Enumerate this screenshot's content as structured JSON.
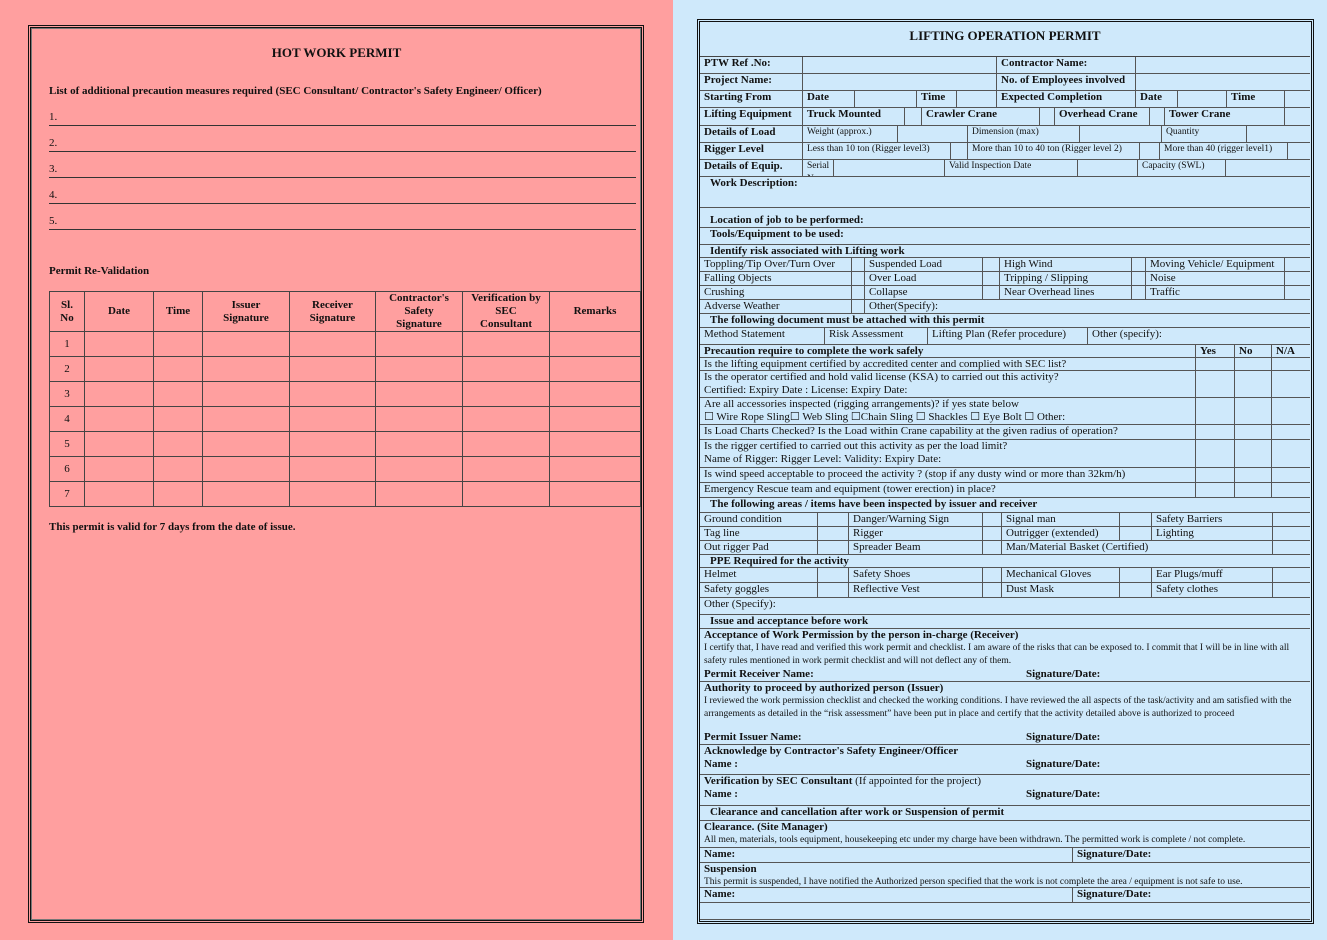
{
  "hot_work": {
    "title": "HOT WORK PERMIT",
    "precaution_heading": "List of additional precaution measures required (SEC Consultant/ Contractor's Safety Engineer/ Officer)",
    "precaution_items": [
      "1.",
      "2.",
      "3.",
      "4.",
      "5."
    ],
    "revalidation_heading": "Permit Re-Validation",
    "table_headers": [
      "Sl.\nNo",
      "Date",
      "Time",
      "Issuer\nSignature",
      "Receiver\nSignature",
      "Contractor's\nSafety\nSignature",
      "Verification by\nSEC\nConsultant",
      "Remarks"
    ],
    "row_numbers": [
      "1",
      "2",
      "3",
      "4",
      "5",
      "6",
      "7"
    ],
    "validity_note": "This permit is valid for 7 days from the date of issue."
  },
  "lifting": {
    "title": "LIFTING OPERATION PERMIT",
    "rows": [
      {
        "cells": [
          "PTW Ref .No:",
          "",
          "Contractor Name:",
          ""
        ]
      },
      {
        "cells": [
          "Project Name:",
          "",
          "No. of Employees involved",
          ""
        ]
      },
      {
        "cells": [
          "Starting From",
          "Date",
          "",
          "Time",
          "",
          "Expected Completion",
          "Date",
          "",
          "Time",
          ""
        ]
      },
      {
        "cells": [
          "Lifting Equipment",
          "Truck Mounted",
          "",
          "Crawler Crane",
          "",
          "Overhead Crane",
          "",
          "Tower Crane",
          ""
        ]
      },
      {
        "cells": [
          "Details of Load",
          "Weight (approx.)",
          "",
          "Dimension (max)",
          "",
          "Quantity",
          ""
        ]
      },
      {
        "cells": [
          "Rigger Level",
          "Less than 10 ton  (Rigger  level3)",
          "",
          "More than 10 to 40 ton  (Rigger level 2)",
          "",
          "More than 40 (rigger level1)",
          ""
        ]
      },
      {
        "cells": [
          "Details of Equip.",
          "Serial  No",
          "",
          "Valid Inspection Date",
          "",
          "Capacity (SWL)",
          ""
        ]
      },
      {
        "cells": [
          "Work Description:"
        ]
      },
      {
        "cells": [
          "Location of job to be performed:"
        ]
      },
      {
        "cells": [
          "Tools/Equipment to be used:"
        ]
      },
      {
        "cells": [
          "Identify risk associated with Lifting  work"
        ]
      },
      {
        "cells": [
          "Toppling/Tip Over/Turn Over",
          "",
          "Suspended Load",
          "",
          "High Wind",
          "",
          "Moving Vehicle/ Equipment",
          ""
        ]
      },
      {
        "cells": [
          "Falling Objects",
          "",
          "Over Load",
          "",
          "Tripping / Slipping",
          "",
          "Noise",
          ""
        ]
      },
      {
        "cells": [
          "Crushing",
          "",
          "Collapse",
          "",
          "Near Overhead lines",
          "",
          "Traffic",
          ""
        ]
      },
      {
        "cells": [
          "Adverse Weather",
          "",
          "Other(Specify):"
        ]
      },
      {
        "cells": [
          "The following  document must be attached with this permit"
        ]
      },
      {
        "cells": [
          "Method Statement",
          "Risk Assessment",
          "Lifting Plan (Refer procedure)",
          "Other (specify):"
        ]
      },
      {
        "cells": [
          "Precaution require to complete the work safely",
          "Yes",
          "No",
          "N/A"
        ]
      },
      {
        "cells": [
          "Is the lifting equipment certified by accredited center and complied with SEC  list?",
          "",
          "",
          ""
        ]
      },
      {
        "cells": [
          "Is the operator certified and hold valid license (KSA) to carried out this activity?\nCertified: Expiry Date :                                   License:  Expiry  Date:",
          "",
          "",
          ""
        ]
      },
      {
        "cells": [
          "Are all accessories inspected (rigging arrangements)? if yes state below\n☐ Wire Rope Sling☐  Web Sling  ☐Chain Sling  ☐ Shackles  ☐  Eye Bolt  ☐ Other:",
          "",
          "",
          ""
        ]
      },
      {
        "cells": [
          "Is Load Charts Checked? Is the Load within Crane capability at the given radius of operation?",
          "",
          "",
          ""
        ]
      },
      {
        "cells": [
          "Is the rigger certified to carried out this activity as per the load limit?\nName of Rigger:                              Rigger Level:                   Validity:  Expiry Date:",
          "",
          "",
          ""
        ]
      },
      {
        "cells": [
          "Is wind speed  acceptable to proceed the activity ? (stop if any dusty wind or more than 32km/h)",
          "",
          "",
          ""
        ]
      },
      {
        "cells": [
          "Emergency Rescue team and equipment (tower erection) in place?",
          "",
          "",
          ""
        ]
      },
      {
        "cells": [
          "The following areas / items have been inspected by issuer and receiver"
        ]
      },
      {
        "cells": [
          "Ground condition",
          "",
          "Danger/Warning Sign",
          "",
          "Signal man",
          "",
          "Safety Barriers",
          ""
        ]
      },
      {
        "cells": [
          "Tag line",
          "",
          "Rigger",
          "",
          "Outrigger (extended)",
          "",
          "Lighting",
          ""
        ]
      },
      {
        "cells": [
          "Out rigger Pad",
          "",
          "Spreader Beam",
          "",
          "Man/Material Basket (Certified)",
          ""
        ]
      },
      {
        "cells": [
          "PPE Required for the activity"
        ]
      },
      {
        "cells": [
          "Helmet",
          "",
          "Safety Shoes",
          "",
          "Mechanical Gloves",
          "",
          "Ear Plugs/muff",
          ""
        ]
      },
      {
        "cells": [
          "Safety goggles",
          "",
          "Reflective Vest",
          "",
          "Dust  Mask",
          "",
          "Safety clothes",
          ""
        ]
      },
      {
        "cells": [
          "Other (Specify):"
        ]
      },
      {
        "cells": [
          "Issue and acceptance before work"
        ]
      },
      {
        "title": "Acceptance of Work Permission by the person in-charge (Receiver)",
        "body": "I certify that, I have read and verified this work permit and checklist. I am aware of the risks that can be exposed to. I commit that I will be in line with all safety rules mentioned in work permit checklist and will not deflect any of them.",
        "name": "Permit Receiver Name:",
        "sig": "Signature/Date:"
      },
      {
        "title": "Authority to proceed by authorized person (Issuer)",
        "body": "I reviewed the work permission checklist and checked the working conditions. I have reviewed the all aspects of the task/activity and am satisfied with the arrangements as detailed in the “risk assessment” have been put in place and certify that the activity detailed above  is authorized to proceed",
        "name": "Permit Issuer Name:",
        "sig": "Signature/Date:"
      },
      {
        "title": "Acknowledge by Contractor's Safety Engineer/Officer",
        "name": "Name :",
        "sig": "Signature/Date:"
      },
      {
        "title": "Verification by SEC Consultant",
        "note": " (If appointed for the project)",
        "name": "Name :",
        "sig": "Signature/Date:"
      },
      {
        "cells": [
          "Clearance and cancellation after work or Suspension of permit"
        ]
      },
      {
        "title": "Clearance. (Site Manager)",
        "body": " All men, materials, tools equipment, housekeeping  etc under my charge have been withdrawn. The permitted work is complete / not complete."
      },
      {
        "cells": [
          "Name:",
          "Signature/Date:"
        ]
      },
      {
        "title": "Suspension",
        "body": "This permit is suspended, I have notified the Authorized person specified that the work is not complete the area / equipment is not safe to use."
      },
      {
        "cells": [
          "Name:",
          "Signature/Date:"
        ]
      },
      {
        "cells": [
          ""
        ]
      }
    ]
  },
  "colors": {
    "hot_work_bg": "#ff9f9f",
    "lifting_bg": "#cfe9fb"
  }
}
